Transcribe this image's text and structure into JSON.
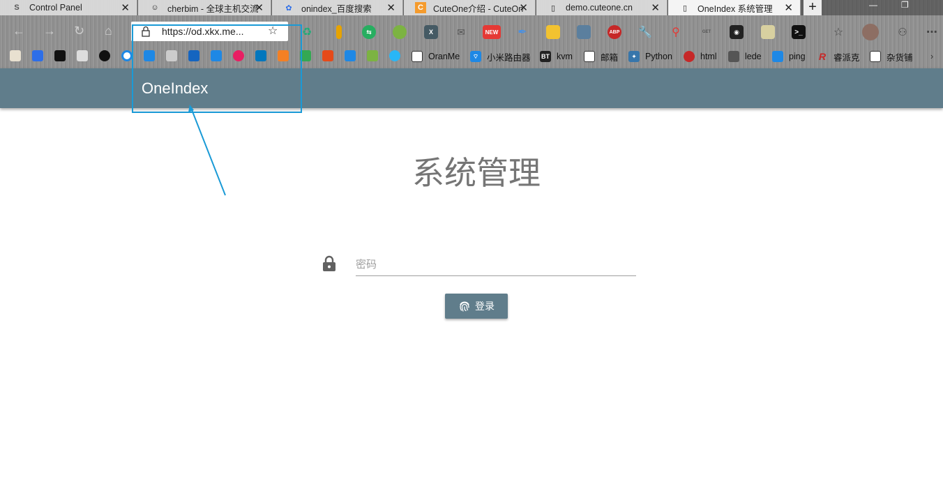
{
  "browser": {
    "tabs": [
      {
        "title": "Control Panel",
        "icon": "s-logo-icon"
      },
      {
        "title": "cherbim - 全球主机交流",
        "icon": "shield-face-icon"
      },
      {
        "title": "onindex_百度搜索",
        "icon": "baidu-paw-icon"
      },
      {
        "title": "CuteOne介绍 - CuteOne",
        "icon": "c-orange-icon"
      },
      {
        "title": "demo.cuteone.cn",
        "icon": "page-icon"
      },
      {
        "title": "OneIndex 系统管理",
        "icon": "page-icon"
      }
    ],
    "url": "https://od.xkx.me...",
    "new_badge": "NEW",
    "abp_badge": "ABP",
    "bookmarks": [
      {
        "label": "OranMe"
      },
      {
        "label": "小米路由器"
      },
      {
        "label": "kvm",
        "badge": "BT"
      },
      {
        "label": "邮箱"
      },
      {
        "label": "Python"
      },
      {
        "label": "html"
      },
      {
        "label": "lede"
      },
      {
        "label": "ping"
      },
      {
        "label": "睿派克",
        "badge": "R"
      },
      {
        "label": "杂货铺"
      }
    ]
  },
  "app": {
    "brand": "OneIndex",
    "page_title": "系统管理",
    "password_placeholder": "密码",
    "login_label": "登录",
    "accent_color": "#607d8b",
    "highlight_color": "#1a9ad6"
  }
}
